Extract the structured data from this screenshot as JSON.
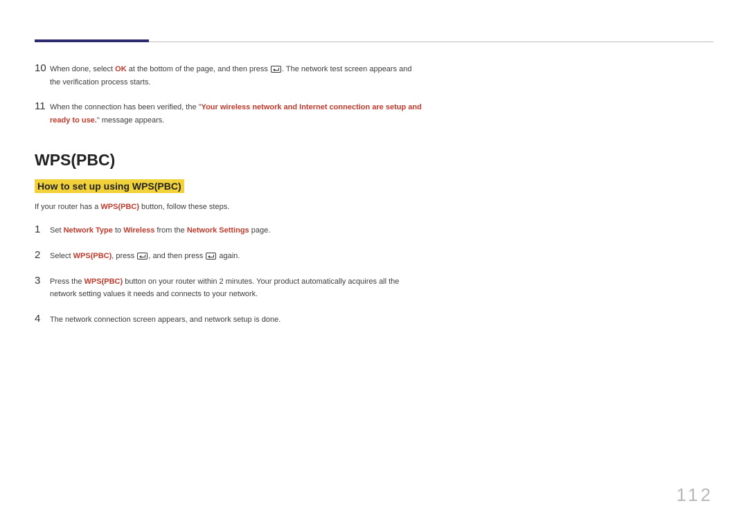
{
  "steps_top": [
    {
      "num": "10",
      "parts": [
        {
          "t": "When done, select "
        },
        {
          "t": "OK",
          "cls": "b-red"
        },
        {
          "t": " at the bottom of the page, and then press "
        },
        {
          "icon": "enter"
        },
        {
          "t": ". The network test screen appears and the verification process starts."
        }
      ]
    },
    {
      "num": "11",
      "parts": [
        {
          "t": "When the connection has been verified, the \""
        },
        {
          "t": "Your wireless network and Internet connection are setup and ready to use.",
          "cls": "b-red"
        },
        {
          "t": "\" message appears."
        }
      ]
    }
  ],
  "section_title": "WPS(PBC)",
  "subsection_title": "How to set up using WPS(PBC)",
  "intro_parts": [
    {
      "t": "If your router has a "
    },
    {
      "t": "WPS(PBC)",
      "cls": "b-red"
    },
    {
      "t": " button, follow these steps."
    }
  ],
  "steps_main": [
    {
      "num": "1",
      "parts": [
        {
          "t": "Set "
        },
        {
          "t": "Network Type",
          "cls": "b-red"
        },
        {
          "t": " to "
        },
        {
          "t": "Wireless",
          "cls": "b-red"
        },
        {
          "t": " from the "
        },
        {
          "t": "Network Settings",
          "cls": "b-red"
        },
        {
          "t": " page."
        }
      ]
    },
    {
      "num": "2",
      "parts": [
        {
          "t": "Select "
        },
        {
          "t": "WPS(PBC)",
          "cls": "b-red"
        },
        {
          "t": ", press "
        },
        {
          "icon": "enter"
        },
        {
          "t": ", and then press "
        },
        {
          "icon": "enter"
        },
        {
          "t": " again."
        }
      ]
    },
    {
      "num": "3",
      "parts": [
        {
          "t": "Press the "
        },
        {
          "t": "WPS(PBC)",
          "cls": "b-red"
        },
        {
          "t": " button on your router within 2 minutes. Your product automatically acquires all the network setting values it needs and connects to your network."
        }
      ]
    },
    {
      "num": "4",
      "parts": [
        {
          "t": "The network connection screen appears, and network setup is done."
        }
      ]
    }
  ],
  "page_number": "112"
}
